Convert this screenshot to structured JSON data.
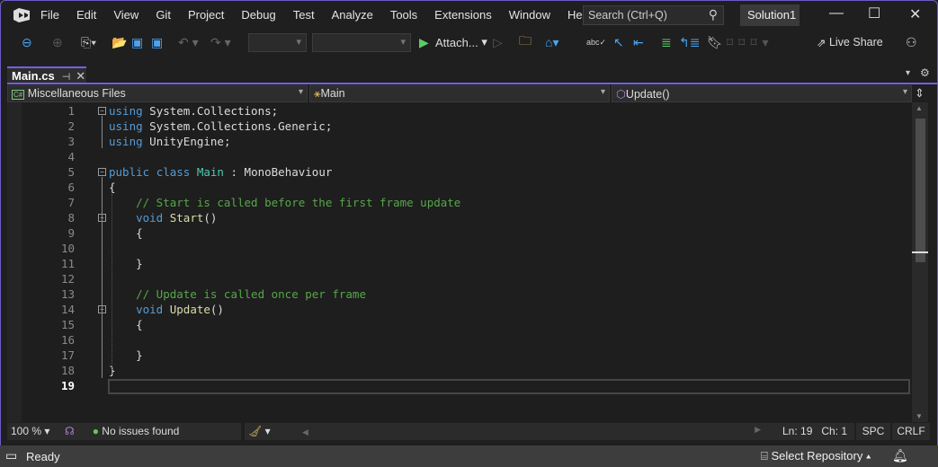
{
  "menu": [
    "File",
    "Edit",
    "View",
    "Git",
    "Project",
    "Debug",
    "Test",
    "Analyze",
    "Tools",
    "Extensions",
    "Window",
    "Help"
  ],
  "search": {
    "placeholder": "Search (Ctrl+Q)"
  },
  "solution": "Solution1",
  "toolbar": {
    "attach": "Attach...",
    "live_share": "Live Share"
  },
  "tab": {
    "label": "Main.cs"
  },
  "nav": {
    "project": "Miscellaneous Files",
    "class": "Main",
    "member": "Update()"
  },
  "editor": {
    "line_numbers": [
      "1",
      "2",
      "3",
      "4",
      "5",
      "6",
      "7",
      "8",
      "9",
      "10",
      "11",
      "12",
      "13",
      "14",
      "15",
      "16",
      "17",
      "18",
      "19"
    ],
    "current_line": 19,
    "lines": [
      [
        [
          "using",
          "kw"
        ],
        [
          " System.Collections;",
          "pl"
        ]
      ],
      [
        [
          "using",
          "kw"
        ],
        [
          " System.Collections.Generic;",
          "pl"
        ]
      ],
      [
        [
          "using",
          "kw"
        ],
        [
          " UnityEngine;",
          "pl"
        ]
      ],
      [],
      [
        [
          "public",
          "kw"
        ],
        [
          " ",
          "pl"
        ],
        [
          "class",
          "kw"
        ],
        [
          " ",
          "pl"
        ],
        [
          "Main",
          "ty"
        ],
        [
          " : MonoBehaviour",
          "pl"
        ]
      ],
      [
        [
          "{",
          "pl"
        ]
      ],
      [
        [
          "    // Start is called before the first frame update",
          "cm"
        ]
      ],
      [
        [
          "    ",
          "pl"
        ],
        [
          "void",
          "kw"
        ],
        [
          " ",
          "pl"
        ],
        [
          "Start",
          "fn"
        ],
        [
          "()",
          "pl"
        ]
      ],
      [
        [
          "    {",
          "pl"
        ]
      ],
      [],
      [
        [
          "    }",
          "pl"
        ]
      ],
      [],
      [
        [
          "    // Update is called once per frame",
          "cm"
        ]
      ],
      [
        [
          "    ",
          "pl"
        ],
        [
          "void",
          "kw"
        ],
        [
          " ",
          "pl"
        ],
        [
          "Update",
          "fn"
        ],
        [
          "()",
          "pl"
        ]
      ],
      [
        [
          "    {",
          "pl"
        ]
      ],
      [],
      [
        [
          "    }",
          "pl"
        ]
      ],
      [
        [
          "}",
          "pl"
        ]
      ],
      []
    ]
  },
  "editor_status": {
    "zoom": "100 %",
    "issues": "No issues found",
    "line": "Ln: 19",
    "col": "Ch: 1",
    "whitespace": "SPC",
    "line_ending": "CRLF"
  },
  "status": {
    "ready": "Ready",
    "repo": "Select Repository"
  }
}
